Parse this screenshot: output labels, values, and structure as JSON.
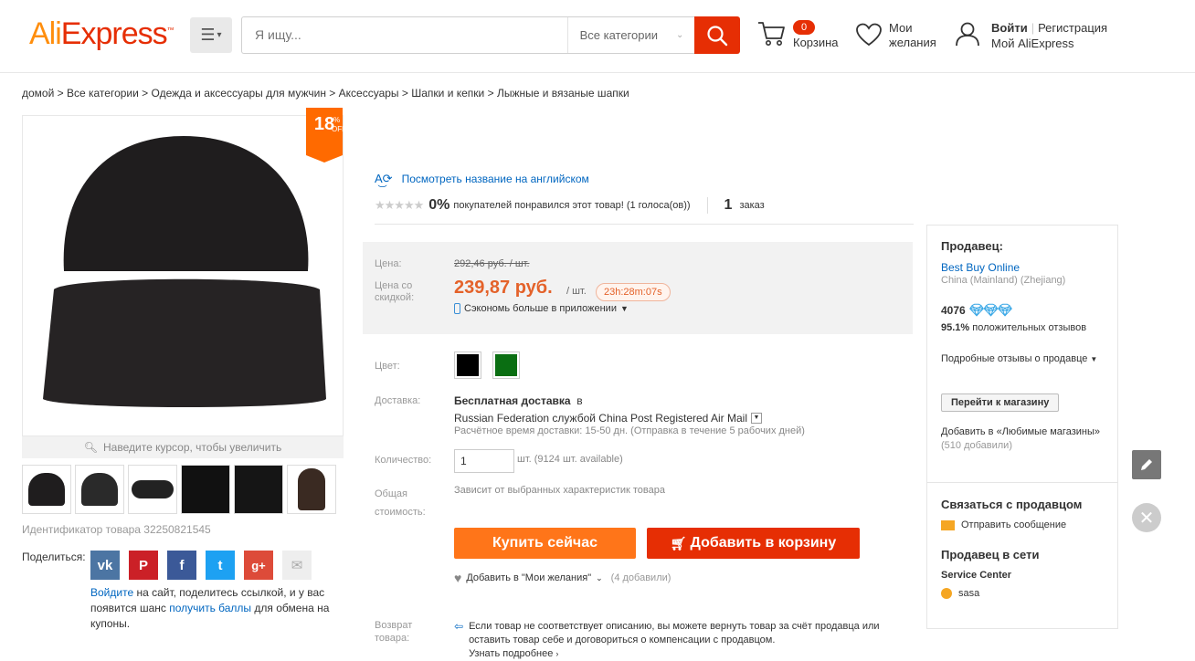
{
  "header": {
    "logo_part1": "Ali",
    "logo_part2": "Express",
    "search_placeholder": "Я ищу...",
    "category_select": "Все категории",
    "cart_count": "0",
    "cart_label": "Корзина",
    "wishlist_label": "Мои желания",
    "login": "Войти",
    "register": "Регистрация",
    "my_account": "Мой AliExpress"
  },
  "breadcrumb": [
    "домой",
    "Все категории",
    "Одежда и аксессуары для мужчин",
    "Аксессуары",
    "Шапки и кепки",
    "Лыжные и вязаные шапки"
  ],
  "gallery": {
    "discount_value": "18",
    "discount_pct": "%",
    "discount_off": "OFF",
    "zoom_hint": "Наведите курсор, чтобы увеличить",
    "thumbnails": 6,
    "product_id": "Идентификатор товара 32250821545"
  },
  "share": {
    "label": "Поделиться:",
    "networks": [
      "vk",
      "pinterest",
      "facebook",
      "twitter",
      "google-plus",
      "email"
    ],
    "note_link1": "Войдите",
    "note_text1": " на сайт, поделитесь ссылкой, и у вас появится шанс ",
    "note_link2": "получить баллы",
    "note_text2": " для обмена на купоны."
  },
  "product": {
    "translate_link": "Посмотреть название на английском",
    "rating_percent": "0%",
    "rating_text": "покупателей понравился этот товар! (1 голоса(ов))",
    "orders_count": "1",
    "orders_label": "заказ"
  },
  "price": {
    "price_label": "Цена:",
    "old_price": "292,46 руб. / шт.",
    "discount_label": "Цена со скидкой:",
    "new_price": "239,87 руб.",
    "per_unit": "/ шт.",
    "timer": "23h:28m:07s",
    "app_save": "Сэкономь больше в приложении"
  },
  "options": {
    "color_label": "Цвет:",
    "colors": [
      "#000000",
      "#0a6e12"
    ],
    "shipping_label": "Доставка:",
    "shipping_free": "Бесплатная доставка",
    "shipping_in": "в",
    "shipping_service": "Russian Federation службой China Post Registered Air Mail",
    "shipping_time": "Расчётное время доставки: 15-50 дн. (Отправка в течение 5 рабочих дней)",
    "qty_label": "Количество:",
    "qty_value": "1",
    "qty_available": "шт. (9124 шт. available)",
    "total_label": "Общая стоимость:",
    "total_note": "Зависит от выбранных характеристик товара"
  },
  "actions": {
    "buy_now": "Купить сейчас",
    "add_to_cart": "Добавить в корзину",
    "add_wishlist": "Добавить в \"Мои желания\"",
    "wishlist_count": "(4 добавили)"
  },
  "returns": {
    "label": "Возврат товара:",
    "text": "Если товар не соответствует описанию, вы можете вернуть товар за счёт продавца или оставить товар себе и договориться о компенсации с продавцом.",
    "more": "Узнать подробнее"
  },
  "seller": {
    "heading": "Продавец:",
    "store_name": "Best Buy Online",
    "location": "China (Mainland) (Zhejiang)",
    "score": "4076",
    "positive_pct": "95.1%",
    "positive_text": "положительных отзывов",
    "detailed_reviews": "Подробные отзывы о продавце",
    "go_to_store": "Перейти к магазину",
    "add_fav": "Добавить в «Любимые магазины»",
    "fav_count": "(510 добавили)",
    "contact_heading": "Связаться с продавцом",
    "send_message": "Отправить сообщение",
    "online_heading": "Продавец в сети",
    "service_center": "Service Center",
    "agent": "sasa"
  }
}
